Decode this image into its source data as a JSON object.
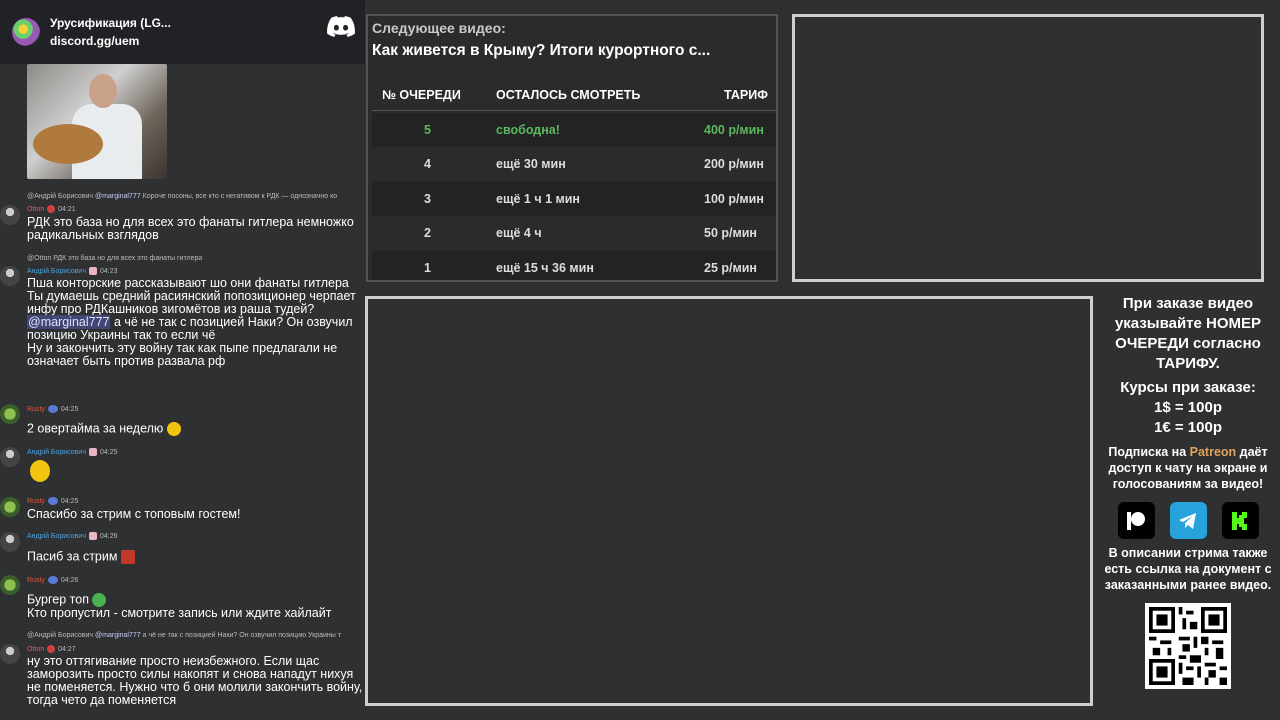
{
  "chat": {
    "server_name": "Урусификация (LG...",
    "invite": "discord.gg/uem",
    "messages": [
      {
        "reply_user": "@Андрій Борисович",
        "reply_mention": "@marginal777",
        "reply_text": "Короче посоны, все кто с негативом к РДК — однозначно ко",
        "author": "Otton",
        "time": "04:21",
        "text": "РДК это база но для всех это фанаты гитлера немножко радикальных взглядов"
      },
      {
        "reply_user": "@Otton",
        "reply_text": "РДК это база но для всех это фанаты гитлера",
        "author": "Андрій Борисович",
        "time": "04:23",
        "text1": "Пша конторские рассказывают шо они фанаты гитлера",
        "text2": "Ты думаешь средний расиянский попозиционер черпает инфу про РДКашников зигомётов из раша тудей?",
        "mention": "@marginal777",
        "text3": " а чё не так с позицией Наки? Он озвучил позицию Украины так то если чё",
        "text4": "Ну и закончить эту войну так как пыпе предлагали не означает быть против развала рф"
      },
      {
        "author": "Rusty",
        "time": "04:25",
        "text": "2 овертайма за неделю"
      },
      {
        "author": "Андрій Борисович",
        "time": "04:25"
      },
      {
        "author": "Rusty",
        "time": "04:25",
        "text": "Спасибо за стрим с топовым гостем!"
      },
      {
        "author": "Андрій Борисович",
        "time": "04:26",
        "text": "Пасиб за стрим"
      },
      {
        "author": "Rusty",
        "time": "04:26",
        "text1": "Бургер топ",
        "text2": "Кто пропустил - смотрите запись или ждите хайлайт"
      },
      {
        "reply_user": "@Андрій Борисович",
        "reply_mention": "@marginal777",
        "reply_text": "а чё не так с позицией Наки? Он озвучил позицию Украины т",
        "author": "Otton",
        "time": "04:27",
        "text": "ну это оттягивание просто неизбежного. Если щас заморозить просто силы накопят и снова нападут нихуя не поменяется. Нужно что б они молили закончить войну, тогда чето да поменяется"
      }
    ]
  },
  "queue": {
    "next_label": "Следующее видео:",
    "next_title": "Как живется в Крыму? Итоги курортного с...",
    "headers": {
      "num": "№ ОЧЕРЕДИ",
      "left": "ОСТАЛОСЬ СМОТРЕТЬ",
      "tariff": "ТАРИФ"
    },
    "rows": [
      {
        "num": "5",
        "left": "свободна!",
        "tariff": "400 р/мин"
      },
      {
        "num": "4",
        "left": "ещё 30 мин",
        "tariff": "200 р/мин"
      },
      {
        "num": "3",
        "left": "ещё 1 ч 1 мин",
        "tariff": "100 р/мин"
      },
      {
        "num": "2",
        "left": "ещё 4 ч",
        "tariff": "50 р/мин"
      },
      {
        "num": "1",
        "left": "ещё 15 ч 36 мин",
        "tariff": "25 р/мин"
      }
    ]
  },
  "info": {
    "order_text": "При заказе видео указывайте НОМЕР ОЧЕРЕДИ согласно ТАРИФУ.",
    "rates_title": "Курсы при заказе:",
    "rate_usd": "1$ = 100р",
    "rate_eur": "1€ = 100р",
    "sub_prefix": "Подписка на ",
    "sub_patreon": "Patreon",
    "sub_rest": " даёт доступ к чату на экране и голосованиям за видео!",
    "desc_text": "В описании стрима также есть ссылка на документ с заказанными ранее видео."
  }
}
